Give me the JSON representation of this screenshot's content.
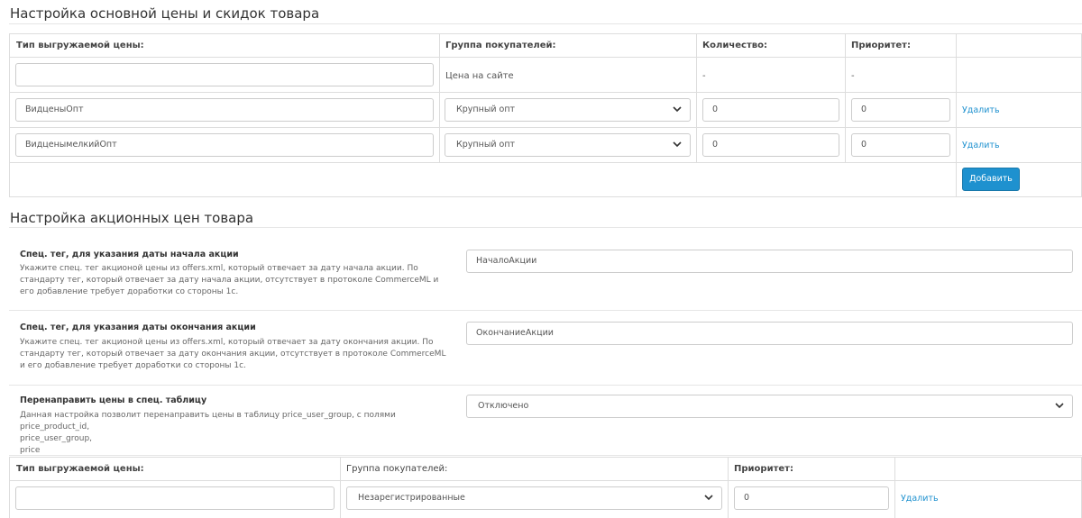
{
  "section1": {
    "title": "Настройка основной цены и скидок товара",
    "headers": {
      "price_type": "Тип выгружаемой цены:",
      "customer_group": "Группа покупателей:",
      "quantity": "Количество:",
      "priority": "Приоритет:"
    },
    "base_row": {
      "price_type_value": "",
      "customer_group_text": "Цена на сайте",
      "quantity_text": "-",
      "priority_text": "-"
    },
    "rows": [
      {
        "price_type": "ВидценыОпт",
        "customer_group": "Крупный опт",
        "quantity": "0",
        "priority": "0",
        "delete_label": "Удалить"
      },
      {
        "price_type": "ВидценымелкийОпт",
        "customer_group": "Крупный опт",
        "quantity": "0",
        "priority": "0",
        "delete_label": "Удалить"
      }
    ],
    "add_button_label": "Добавить"
  },
  "section2": {
    "title": "Настройка акционных цен товара",
    "settings": [
      {
        "label": "Спец. тег, для указания даты начала акции",
        "help": "Укажите спец. тег акционой цены из offers.xml, который отвечает за дату начала акции. По стандарту тег, который отвечает за дату начала акции, отсутствует в протоколе CommerceML и его добавление требует доработки со стороны 1с.",
        "value": "НачалоАкции"
      },
      {
        "label": "Спец. тег, для указания даты окончания акции",
        "help": "Укажите спец. тег акционой цены из offers.xml, который отвечает за дату окончания акции. По стандарту тег, который отвечает за дату окончания акции, отсутствует в протоколе CommerceML и его добавление требует доработки со стороны 1с.",
        "value": "ОкончаниеАкции"
      },
      {
        "label": "Перенаправить цены в спец. таблицу",
        "help_lines": [
          "Данная настройка позволит перенаправить цены в таблицу price_user_group, с полями price_product_id,",
          "price_user_group,",
          "price"
        ],
        "value": "Отключено"
      }
    ],
    "table": {
      "headers": {
        "price_type": "Тип выгружаемой цены:",
        "customer_group": "Группа покупателей:",
        "priority": "Приоритет:"
      },
      "row": {
        "price_type": "",
        "customer_group": "Незарегистрированные",
        "priority": "0",
        "delete_label": "Удалить"
      }
    }
  }
}
